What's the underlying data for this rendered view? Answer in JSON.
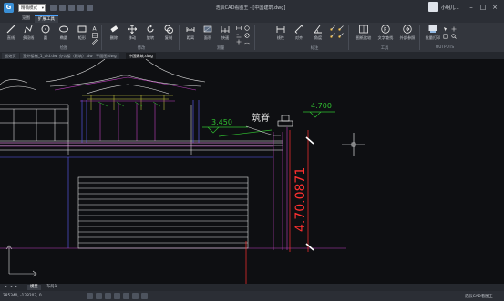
{
  "app": {
    "title": "浩辰CAD看图王 - [中国建筑.dwg]",
    "logo_char": "G"
  },
  "mode_select": {
    "value": "精确模式"
  },
  "user": {
    "name": "小明儿..."
  },
  "window_controls": [
    "–",
    "□",
    "×"
  ],
  "ribbon_tabs": [
    {
      "label": "览图"
    },
    {
      "label": "扩展工具"
    }
  ],
  "tools": [
    {
      "label": "直线",
      "icon": "line-icon"
    },
    {
      "label": "多段线",
      "icon": "polyline-icon"
    },
    {
      "label": "圆",
      "icon": "circle-icon"
    },
    {
      "label": "椭圆",
      "icon": "ellipse-icon"
    },
    {
      "label": "矩形",
      "icon": "rectangle-icon"
    },
    {
      "label": "文字",
      "icon": "text-icon"
    },
    {
      "label": "删除",
      "icon": "eraser-icon"
    },
    {
      "label": "移动",
      "icon": "move-icon"
    },
    {
      "label": "旋转",
      "icon": "rotate-icon"
    },
    {
      "label": "复制",
      "icon": "copy-icon"
    },
    {
      "label": "距离",
      "icon": "distance-icon"
    },
    {
      "label": "面积",
      "icon": "area-icon"
    },
    {
      "label": "快速",
      "icon": "quick-dim-icon"
    },
    {
      "label": "线性",
      "icon": "linear-dim-icon"
    },
    {
      "label": "对齐",
      "icon": "aligned-dim-icon"
    },
    {
      "label": "角度",
      "icon": "angle-dim-icon"
    },
    {
      "label": "图纸比较",
      "icon": "compare-icon"
    },
    {
      "label": "文字查找",
      "icon": "text-find-icon"
    },
    {
      "label": "外部参照",
      "icon": "xref-icon"
    },
    {
      "label": "批量打印",
      "icon": "batch-print-icon"
    }
  ],
  "groups": [
    {
      "label": "绘图"
    },
    {
      "label": "修改"
    },
    {
      "label": "测量"
    },
    {
      "label": "标注"
    },
    {
      "label": "工具"
    },
    {
      "label": "OUTPUTS"
    }
  ],
  "doc_tabs": [
    {
      "label": "起始页"
    },
    {
      "label": "室外楼梯_1_old.dwg"
    },
    {
      "label": "办公楼（建筑）.dwg"
    },
    {
      "label": "平面图.dwg"
    },
    {
      "label": "中国建筑.dwg"
    }
  ],
  "drawing": {
    "dim_left": "3.450",
    "dim_right": "4.700",
    "label": "筑脊",
    "vertical_dim": "4.70.0871"
  },
  "layout_tabs": [
    {
      "label": "模型"
    },
    {
      "label": "布局1"
    }
  ],
  "status": {
    "coords": "285340, -138207, 0",
    "brand": "浩辰CAD看图王"
  },
  "colors": {
    "accent": "#3a8fd6",
    "canvas": "#0e0f12",
    "magenta": "#c040c0",
    "red": "#ff3030",
    "green": "#20d030"
  }
}
